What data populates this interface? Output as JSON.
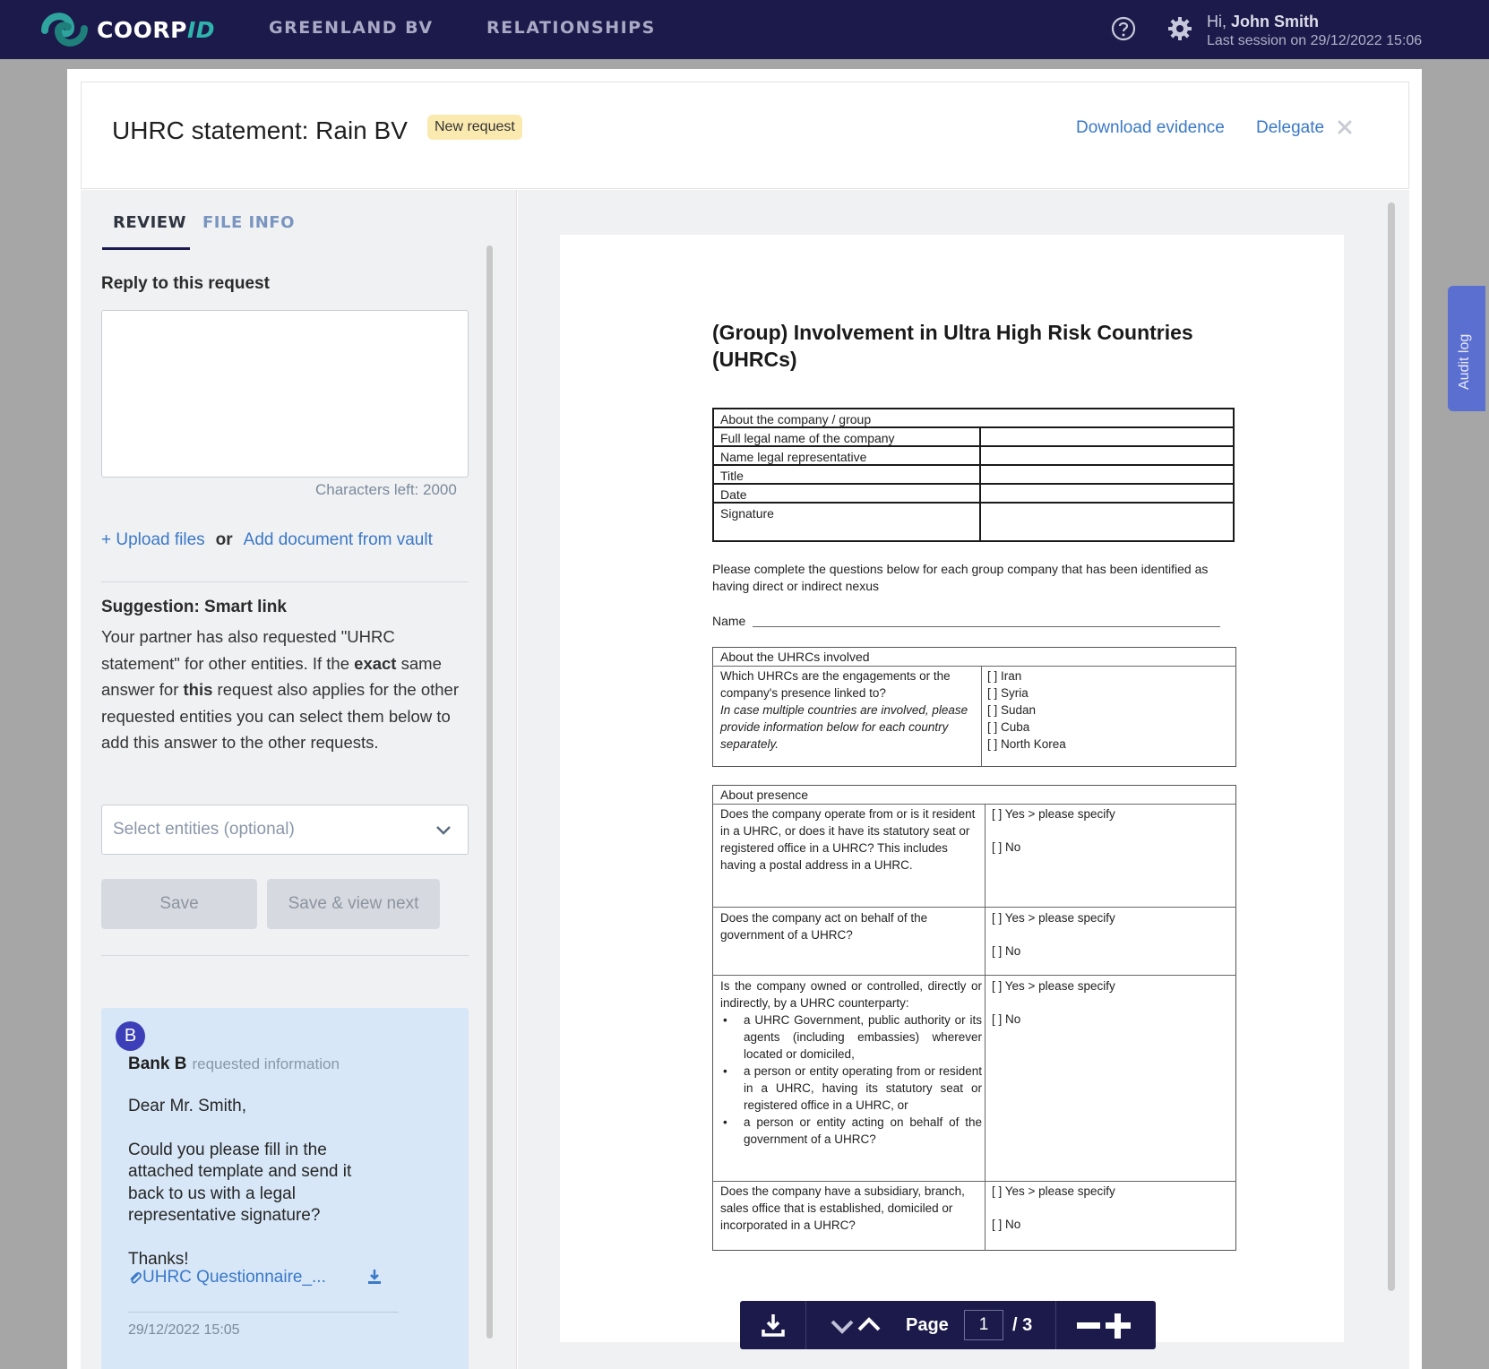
{
  "nav": {
    "logo_main": "COORP",
    "logo_accent": "ID",
    "items": [
      {
        "label": "GREENLAND BV"
      },
      {
        "label": "RELATIONSHIPS"
      }
    ],
    "user_greeting": "Hi, ",
    "user_name": "John Smith",
    "last_session": "Last session on  29/12/2022 15:06"
  },
  "header": {
    "title": "UHRC statement: Rain BV",
    "badge": "New request",
    "download_evidence": "Download evidence",
    "delegate": "Delegate"
  },
  "left": {
    "tabs": [
      {
        "label": "REVIEW"
      },
      {
        "label": "FILE INFO"
      }
    ],
    "reply_label": "Reply to this request",
    "reply_value": "",
    "chars_left": "Characters left: 2000",
    "upload_files": "+ Upload files",
    "or": "or",
    "add_from_vault": "Add document from vault",
    "suggestion_title": "Suggestion: Smart link",
    "suggestion_parts": [
      "Your partner has also requested \"UHRC statement\" for other entities. If the ",
      "exact",
      " same answer for ",
      "this",
      " request also applies for the other requested entities you can select them below to add this answer to the other requests."
    ],
    "select_placeholder": "Select entities (optional)",
    "save": "Save",
    "save_next": "Save & view next"
  },
  "message": {
    "avatar": "B",
    "from": "Bank B",
    "action": "requested information",
    "greeting": "Dear Mr. Smith,",
    "body": "Could you please fill in the attached template and send it back to us with a legal representative signature?",
    "closing": "Thanks!",
    "attachment": "UHRC Questionnaire_...",
    "time": "29/12/2022 15:05"
  },
  "document": {
    "title": "(Group) Involvement in Ultra High Risk Countries (UHRCs)",
    "company_section": "About the company / group",
    "company_rows": [
      "Full legal name of the company",
      "Name legal representative",
      "Title",
      "Date",
      "Signature"
    ],
    "instructions": "Please complete the questions below for each group company that has been identified as having direct or indirect nexus",
    "name_label": "Name",
    "uhrc_section": "About the UHRCs involved",
    "uhrc_question": "Which UHRCs are the engagements or the company's presence linked to?",
    "uhrc_note": "In case multiple countries are involved, please provide information below for each country separately.",
    "countries": [
      "[ ] Iran",
      "[ ] Syria",
      "[ ] Sudan",
      "[ ] Cuba",
      "[ ] North Korea"
    ],
    "presence_section": "About presence",
    "presence_q1": "Does the company operate from or is it resident in a UHRC, or does it have its statutory seat or registered office in a UHRC? This includes having a postal address in a UHRC.",
    "presence_q2": "Does the company act on behalf of the government of a UHRC?",
    "presence_q3_intro": "Is the company owned or controlled, directly or indirectly, by a UHRC counterparty:",
    "presence_q3_bullets": [
      "a UHRC Government, public authority or its agents (including embassies) wherever located or domiciled,",
      "a person or entity operating from or resident in a UHRC, having its statutory seat or registered office in a UHRC, or",
      "a person or entity acting on behalf of the government of a UHRC?"
    ],
    "presence_q4": "Does the company have a subsidiary, branch, sales office that is established, domiciled or incorporated in a UHRC?",
    "yes_specify": "[ ] Yes  > please specify",
    "yes_specify_b": "[ ] Yes > please specify",
    "no": "[ ] No"
  },
  "toolbar": {
    "page_label": "Page",
    "page_value": "1",
    "page_total": "/ 3"
  },
  "audit_log": "Audit log"
}
